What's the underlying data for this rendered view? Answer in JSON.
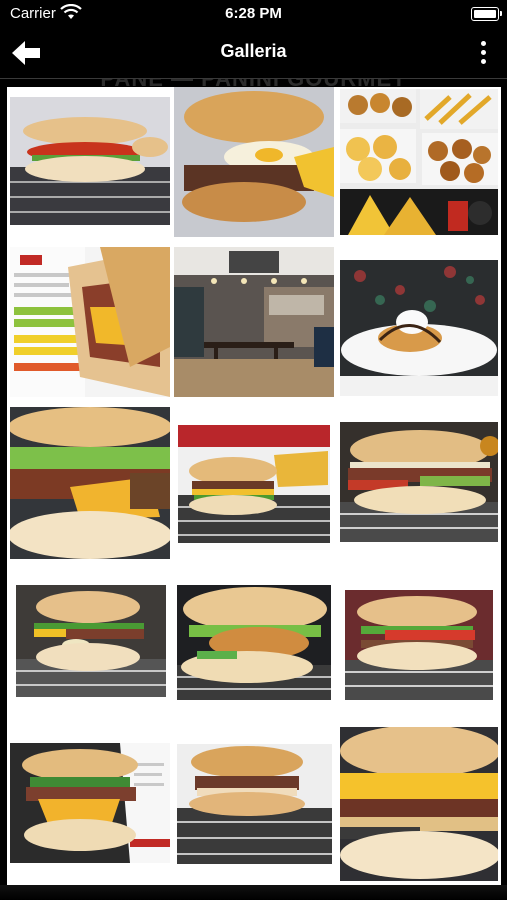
{
  "status_bar": {
    "carrier": "Carrier",
    "time": "6:28 PM"
  },
  "navbar": {
    "title": "Galleria"
  },
  "gallery": {
    "header_strip": "PANE — PANINI GOURMET",
    "images": [
      {
        "name": "panino-pomodoro-rete"
      },
      {
        "name": "panino-uovo-bacon"
      },
      {
        "name": "fritti-misti-patatine"
      },
      {
        "name": "menu-e-panino"
      },
      {
        "name": "interno-locale"
      },
      {
        "name": "dessert-panna"
      },
      {
        "name": "panino-bacon-grande"
      },
      {
        "name": "panino-patatine-rete"
      },
      {
        "name": "panino-carne-rete"
      },
      {
        "name": "panino-verdure-rete"
      },
      {
        "name": "panino-cotoletta"
      },
      {
        "name": "panino-pomodoro-verdure"
      },
      {
        "name": "panino-cheddar-carta"
      },
      {
        "name": "panino-salsiccia-rete"
      },
      {
        "name": "panino-cheddar-grande"
      }
    ]
  }
}
